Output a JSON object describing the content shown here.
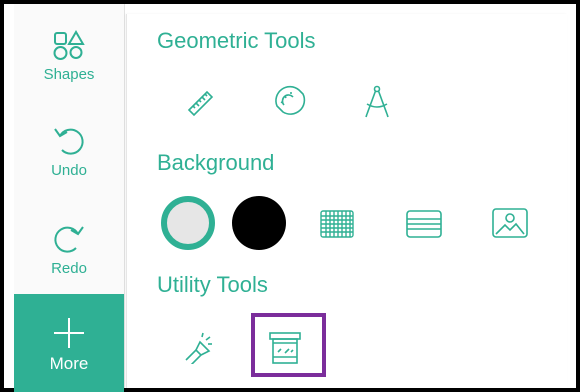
{
  "sidebar": {
    "shapes_label": "Shapes",
    "undo_label": "Undo",
    "redo_label": "Redo",
    "more_label": "More"
  },
  "sections": {
    "geometric": {
      "title": "Geometric Tools",
      "tools": [
        "ruler-icon",
        "protractor-icon",
        "compass-icon"
      ]
    },
    "background": {
      "title": "Background",
      "options": [
        "white-background",
        "black-background",
        "grid-background",
        "lined-background",
        "image-background"
      ],
      "colors": {
        "white": "#e6e6e6",
        "black": "#000000",
        "selected_ring": "#2fb094"
      }
    },
    "utility": {
      "title": "Utility Tools",
      "tools": [
        "flashlight-icon",
        "screen-shade-icon"
      ],
      "highlighted": "screen-shade-icon",
      "highlight_color": "#7b2d9b"
    }
  },
  "accent_color": "#2fb094"
}
